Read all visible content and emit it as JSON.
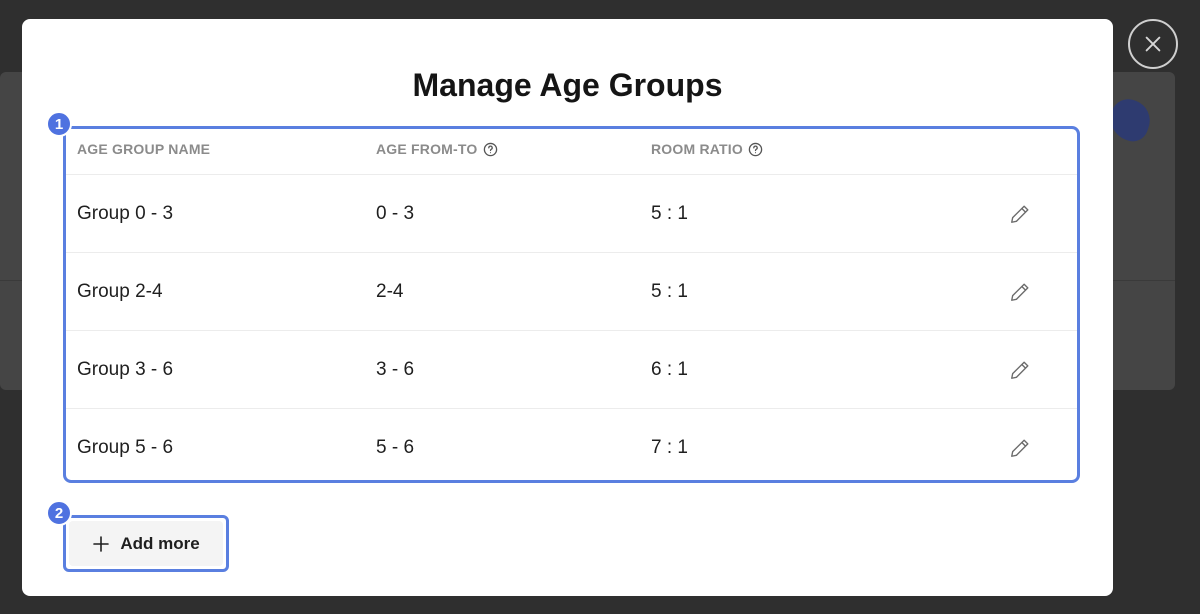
{
  "modal": {
    "title": "Manage Age Groups"
  },
  "badges": {
    "table": "1",
    "add": "2"
  },
  "table": {
    "headers": {
      "name": "AGE GROUP NAME",
      "age": "AGE FROM-TO",
      "ratio": "ROOM RATIO"
    },
    "rows": [
      {
        "name": "Group 0 - 3",
        "age": "0 - 3",
        "ratio": "5 : 1"
      },
      {
        "name": "Group 2-4",
        "age": "2-4",
        "ratio": "5 : 1"
      },
      {
        "name": "Group 3 - 6",
        "age": "3 - 6",
        "ratio": "6 : 1"
      },
      {
        "name": "Group 5 - 6",
        "age": "5 - 6",
        "ratio": "7 : 1"
      }
    ]
  },
  "actions": {
    "add_more_label": "Add more"
  },
  "icons": {
    "close": "close-icon",
    "help": "help-circle-icon",
    "edit": "pencil-icon",
    "add": "plus-icon"
  },
  "colors": {
    "highlight": "#5a7fe0",
    "badge": "#4f72e0",
    "overlay": "#2f2f2f"
  }
}
